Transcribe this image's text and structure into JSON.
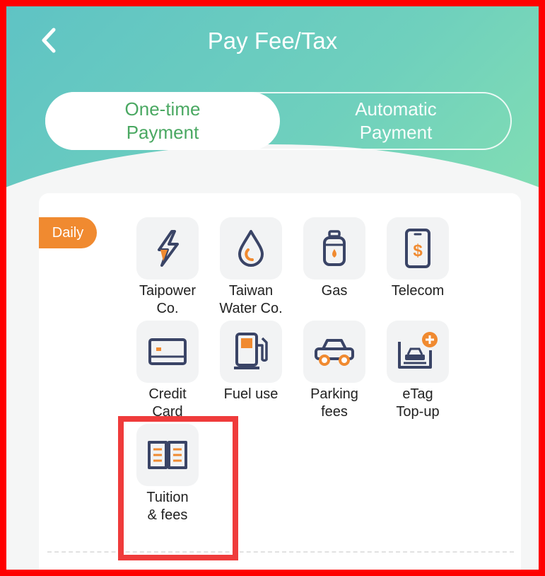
{
  "header": {
    "title": "Pay Fee/Tax",
    "back_icon": "chevron-left-icon"
  },
  "tabs": {
    "active": {
      "label": "One-time\nPayment"
    },
    "inactive": {
      "label": "Automatic\nPayment"
    }
  },
  "section": {
    "badge": "Daily"
  },
  "items": [
    {
      "label": "Taipower\nCo.",
      "icon": "lightning-bolt-icon"
    },
    {
      "label": "Taiwan\nWater Co.",
      "icon": "water-drop-icon"
    },
    {
      "label": "Gas",
      "icon": "gas-canister-icon"
    },
    {
      "label": "Telecom",
      "icon": "mobile-phone-icon"
    },
    {
      "label": "Credit\nCard",
      "icon": "credit-card-icon"
    },
    {
      "label": "Fuel use",
      "icon": "fuel-pump-icon"
    },
    {
      "label": "Parking\nfees",
      "icon": "car-icon"
    },
    {
      "label": "eTag\nTop-up",
      "icon": "etag-topup-icon"
    },
    {
      "label": "Tuition\n& fees",
      "icon": "book-icon"
    }
  ],
  "colors": {
    "accent_orange": "#f08a30",
    "icon_navy": "#3a4466",
    "active_tab_text": "#4aa862",
    "highlight_border": "#ef3b3b",
    "frame_border": "#ff0000"
  }
}
